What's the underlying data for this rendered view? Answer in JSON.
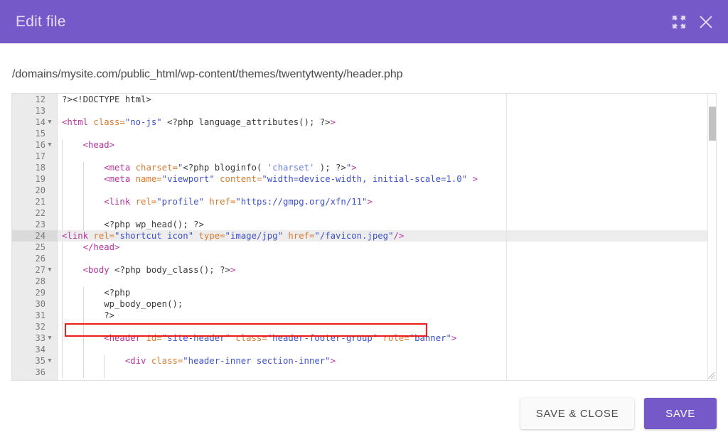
{
  "window": {
    "title": "Edit file",
    "expand_icon": "expand-icon",
    "close_icon": "close-icon"
  },
  "filepath": "/domains/mysite.com/public_html/wp-content/themes/twentytwenty/header.php",
  "editor": {
    "active_line": 24,
    "first_line": 12,
    "last_line": 36,
    "highlight_box_color": "#ee1b1b",
    "lines": [
      {
        "num": 12,
        "fold": false,
        "indent": 0,
        "tokens": [
          {
            "c": "plain",
            "t": "?><!DOCTYPE html>"
          }
        ]
      },
      {
        "num": 13,
        "fold": false,
        "indent": 0,
        "tokens": []
      },
      {
        "num": 14,
        "fold": true,
        "indent": 0,
        "tokens": [
          {
            "c": "tag",
            "t": "<html "
          },
          {
            "c": "attr",
            "t": "class="
          },
          {
            "c": "str",
            "t": "\"no-js\""
          },
          {
            "c": "plain",
            "t": " <?php language_attributes(); ?>"
          },
          {
            "c": "tag",
            "t": ">"
          }
        ]
      },
      {
        "num": 15,
        "fold": false,
        "indent": 0,
        "tokens": []
      },
      {
        "num": 16,
        "fold": true,
        "indent": 1,
        "tokens": [
          {
            "c": "tag",
            "t": "    <head>"
          }
        ]
      },
      {
        "num": 17,
        "fold": false,
        "indent": 1,
        "tokens": []
      },
      {
        "num": 18,
        "fold": false,
        "indent": 2,
        "tokens": [
          {
            "c": "tag",
            "t": "        <meta "
          },
          {
            "c": "attr",
            "t": "charset="
          },
          {
            "c": "str",
            "t": "\""
          },
          {
            "c": "php",
            "t": "<?php bloginfo( "
          },
          {
            "c": "pstr",
            "t": "'charset'"
          },
          {
            "c": "php",
            "t": " ); ?>"
          },
          {
            "c": "str",
            "t": "\""
          },
          {
            "c": "tag",
            "t": ">"
          }
        ]
      },
      {
        "num": 19,
        "fold": false,
        "indent": 2,
        "tokens": [
          {
            "c": "tag",
            "t": "        <meta "
          },
          {
            "c": "attr",
            "t": "name="
          },
          {
            "c": "str",
            "t": "\"viewport\""
          },
          {
            "c": "plain",
            "t": " "
          },
          {
            "c": "attr",
            "t": "content="
          },
          {
            "c": "str",
            "t": "\"width=device-width, initial-scale=1.0\""
          },
          {
            "c": "tag",
            "t": " >"
          }
        ]
      },
      {
        "num": 20,
        "fold": false,
        "indent": 2,
        "tokens": []
      },
      {
        "num": 21,
        "fold": false,
        "indent": 2,
        "tokens": [
          {
            "c": "tag",
            "t": "        <link "
          },
          {
            "c": "attr",
            "t": "rel="
          },
          {
            "c": "str",
            "t": "\"profile\""
          },
          {
            "c": "plain",
            "t": " "
          },
          {
            "c": "attr",
            "t": "href="
          },
          {
            "c": "str",
            "t": "\"https://gmpg.org/xfn/11\""
          },
          {
            "c": "tag",
            "t": ">"
          }
        ]
      },
      {
        "num": 22,
        "fold": false,
        "indent": 2,
        "tokens": []
      },
      {
        "num": 23,
        "fold": false,
        "indent": 2,
        "tokens": [
          {
            "c": "php",
            "t": "        <?php wp_head(); ?>"
          }
        ]
      },
      {
        "num": 24,
        "fold": false,
        "indent": 0,
        "active": true,
        "tokens": [
          {
            "c": "tag",
            "t": "<link "
          },
          {
            "c": "attr",
            "t": "rel="
          },
          {
            "c": "str",
            "t": "\"shortcut icon\""
          },
          {
            "c": "plain",
            "t": " "
          },
          {
            "c": "attr",
            "t": "type="
          },
          {
            "c": "str",
            "t": "\"image/jpg\""
          },
          {
            "c": "plain",
            "t": " "
          },
          {
            "c": "attr",
            "t": "href="
          },
          {
            "c": "str",
            "t": "\"/favicon.jpeg\""
          },
          {
            "c": "tag",
            "t": "/>"
          }
        ]
      },
      {
        "num": 25,
        "fold": false,
        "indent": 1,
        "tokens": [
          {
            "c": "tag",
            "t": "    </head>"
          }
        ]
      },
      {
        "num": 26,
        "fold": false,
        "indent": 1,
        "tokens": []
      },
      {
        "num": 27,
        "fold": true,
        "indent": 1,
        "tokens": [
          {
            "c": "tag",
            "t": "    <body "
          },
          {
            "c": "plain",
            "t": "<?php body_class(); ?>"
          },
          {
            "c": "tag",
            "t": ">"
          }
        ]
      },
      {
        "num": 28,
        "fold": false,
        "indent": 1,
        "tokens": []
      },
      {
        "num": 29,
        "fold": false,
        "indent": 2,
        "tokens": [
          {
            "c": "php",
            "t": "        <?php"
          }
        ]
      },
      {
        "num": 30,
        "fold": false,
        "indent": 2,
        "tokens": [
          {
            "c": "php",
            "t": "        wp_body_open();"
          }
        ]
      },
      {
        "num": 31,
        "fold": false,
        "indent": 2,
        "tokens": [
          {
            "c": "php",
            "t": "        ?>"
          }
        ]
      },
      {
        "num": 32,
        "fold": false,
        "indent": 2,
        "tokens": []
      },
      {
        "num": 33,
        "fold": true,
        "indent": 2,
        "tokens": [
          {
            "c": "tag",
            "t": "        <header "
          },
          {
            "c": "attr",
            "t": "id="
          },
          {
            "c": "str",
            "t": "\"site-header\""
          },
          {
            "c": "plain",
            "t": " "
          },
          {
            "c": "attr",
            "t": "class="
          },
          {
            "c": "str",
            "t": "\"header-footer-group\""
          },
          {
            "c": "plain",
            "t": " "
          },
          {
            "c": "attr",
            "t": "role="
          },
          {
            "c": "str",
            "t": "\"banner\""
          },
          {
            "c": "tag",
            "t": ">"
          }
        ]
      },
      {
        "num": 34,
        "fold": false,
        "indent": 2,
        "tokens": []
      },
      {
        "num": 35,
        "fold": true,
        "indent": 3,
        "tokens": [
          {
            "c": "tag",
            "t": "            <div "
          },
          {
            "c": "attr",
            "t": "class="
          },
          {
            "c": "str",
            "t": "\"header-inner section-inner\""
          },
          {
            "c": "tag",
            "t": ">"
          }
        ]
      },
      {
        "num": 36,
        "fold": false,
        "indent": 3,
        "tokens": []
      }
    ]
  },
  "footer": {
    "save_close_label": "SAVE & CLOSE",
    "save_label": "SAVE"
  },
  "colors": {
    "accent": "#7559c9",
    "tag": "#b3369c",
    "attr": "#d87b30",
    "string": "#3f51c9",
    "php": "#3b3b3b",
    "gutter_bg": "#ebebeb"
  }
}
